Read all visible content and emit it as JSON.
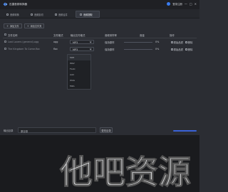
{
  "app": {
    "title": "迅捷音频转换器",
    "login_label": "登录注册"
  },
  "window_controls": [
    "—",
    "□",
    "✕"
  ],
  "tabs": [
    {
      "label": "音频转换"
    },
    {
      "label": "音频剪切"
    },
    {
      "label": "音频合并"
    },
    {
      "label": "音频提取"
    }
  ],
  "toolbar": {
    "add_file": "添加文件",
    "add_folder": "添加文件夹"
  },
  "table": {
    "headers": {
      "name": "文件名称",
      "format": "文件格式",
      "output": "输出文件格式",
      "sample": "音频采样率",
      "volume": "音量",
      "ops": "操作"
    },
    "rows": [
      {
        "name": "Lost Lovers (general).ogg",
        "format": "ogg",
        "output": "MP3",
        "sample": "保持原样",
        "volume": "0%",
        "op1": "原始品质",
        "op2": "删除"
      },
      {
        "name": "The Kingdom To Come.flac",
        "format": "flac",
        "output": "MP3",
        "sample": "保持原样",
        "volume": "0%",
        "op1": "原始品质",
        "op2": "删除"
      }
    ]
  },
  "dropdown": {
    "options": [
      "MP3",
      "WAV",
      "FLAC",
      "AAC",
      "OGG",
      "M4A"
    ]
  },
  "output_dir": {
    "label": "输出目录",
    "value": "原目录",
    "browse_label": "更改目录"
  },
  "watermark": {
    "text": "他吧资源"
  },
  "colors": {
    "accent": "#3a63d8",
    "background": "#2b2d33"
  }
}
